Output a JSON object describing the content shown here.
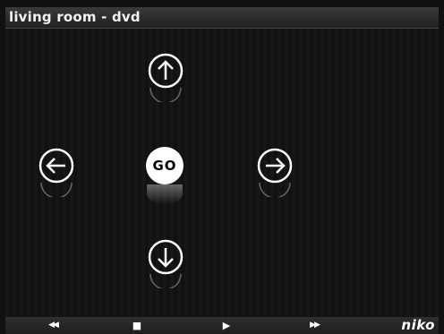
{
  "window": {
    "title": "living room - dvd"
  },
  "nav": {
    "up_icon": "arrow-up-circle-icon",
    "left_icon": "arrow-left-circle-icon",
    "right_icon": "arrow-right-circle-icon",
    "down_icon": "arrow-down-circle-icon",
    "go_label": "GO"
  },
  "transport": {
    "rewind_glyph": "◀◀",
    "stop_glyph": "■",
    "play_glyph": "▶",
    "forward_glyph": "▶▶"
  },
  "brand": {
    "label": "niko"
  },
  "colors": {
    "background": "#111111",
    "icon": "#ffffff",
    "go_fill": "#ffffff",
    "go_text": "#000000"
  }
}
